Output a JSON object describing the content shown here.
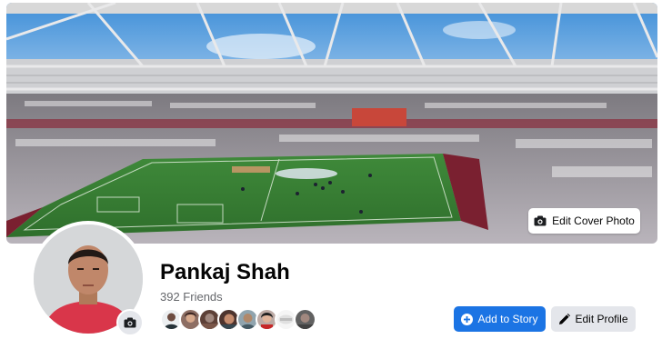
{
  "cover": {
    "edit_label": "Edit Cover Photo",
    "edit_icon": "camera-icon"
  },
  "profile": {
    "name": "Pankaj Shah",
    "friends_label": "392 Friends",
    "avatar_camera_icon": "camera-icon",
    "friend_avatar_count": 8
  },
  "actions": {
    "add_story_label": "Add to Story",
    "add_story_icon": "plus-circle-icon",
    "edit_profile_label": "Edit Profile",
    "edit_profile_icon": "pencil-icon"
  },
  "colors": {
    "primary_blue": "#1b74e4",
    "secondary_gray": "#e4e6eb",
    "text_dark": "#050505",
    "text_muted": "#65676b"
  }
}
